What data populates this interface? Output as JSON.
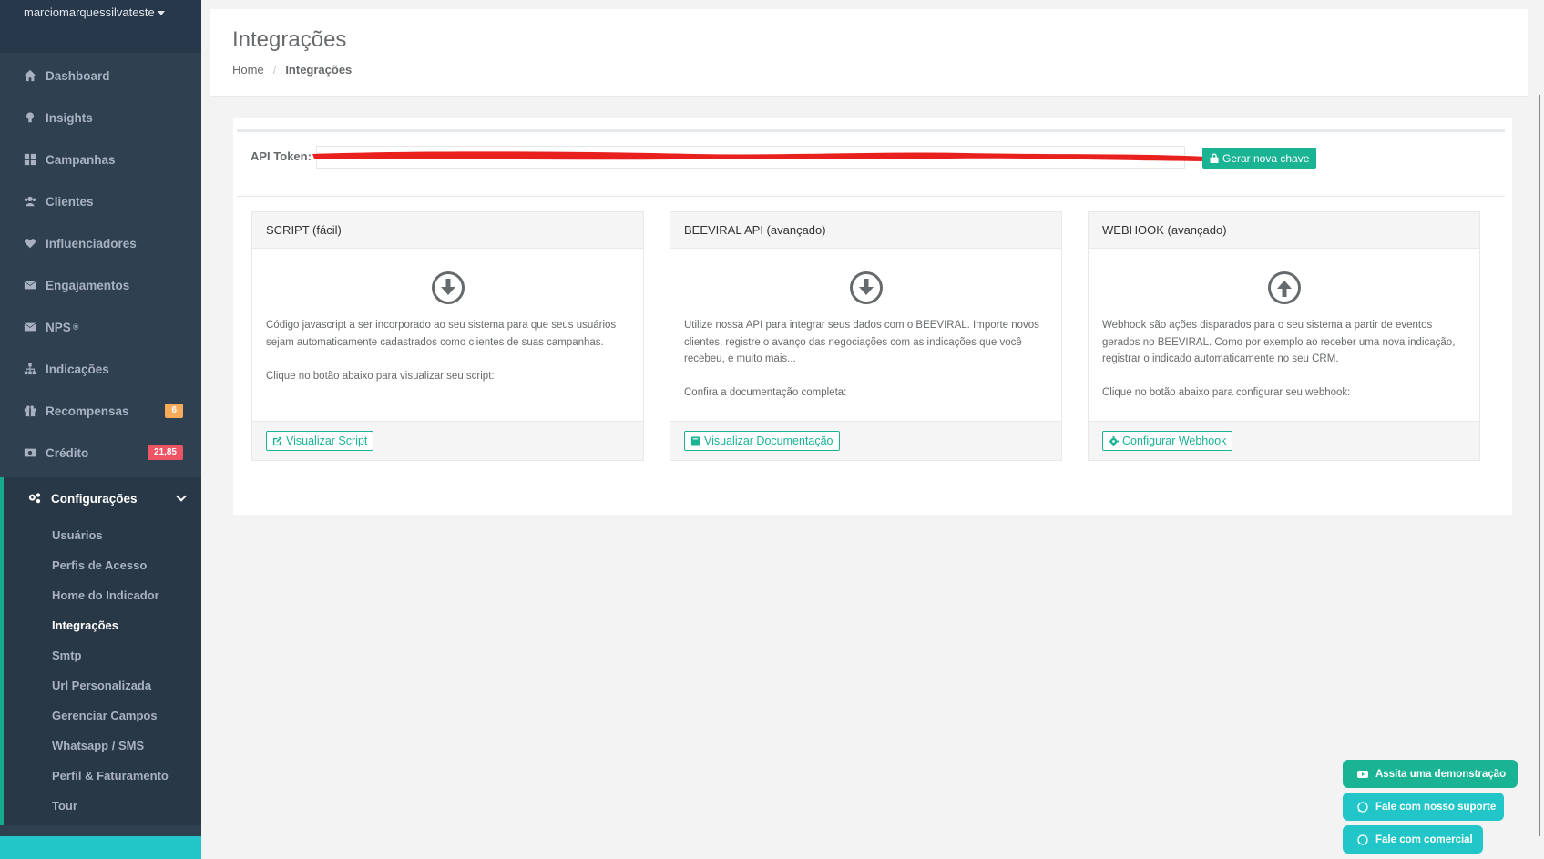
{
  "user": {
    "name": "marciomarquessilvateste"
  },
  "sidebar": {
    "items": [
      {
        "label": "Dashboard",
        "icon": "home-icon"
      },
      {
        "label": "Insights",
        "icon": "lightbulb-icon"
      },
      {
        "label": "Campanhas",
        "icon": "grid-icon"
      },
      {
        "label": "Clientes",
        "icon": "users-icon"
      },
      {
        "label": "Influenciadores",
        "icon": "heart-icon"
      },
      {
        "label": "Engajamentos",
        "icon": "envelope-icon"
      },
      {
        "label": "NPS",
        "sup": "®",
        "icon": "envelope-icon"
      },
      {
        "label": "Indicações",
        "icon": "sitemap-icon"
      },
      {
        "label": "Recompensas",
        "icon": "gift-icon",
        "badge": "6"
      },
      {
        "label": "Crédito",
        "icon": "money-icon",
        "badge": "21,85"
      }
    ],
    "config": {
      "label": "Configurações",
      "subitems": [
        "Usuários",
        "Perfis de Acesso",
        "Home do Indicador",
        "Integrações",
        "Smtp",
        "Url Personalizada",
        "Gerenciar Campos",
        "Whatsapp / SMS",
        "Perfil & Faturamento",
        "Tour"
      ]
    }
  },
  "header": {
    "title": "Integrações",
    "breadcrumb": {
      "home": "Home",
      "current": "Integrações"
    }
  },
  "token": {
    "label": "API Token:",
    "button": "Gerar nova chave"
  },
  "cards": [
    {
      "title": "SCRIPT (fácil)",
      "icon": "download-circle-icon",
      "text1": "Código javascript a ser incorporado ao seu sistema para que seus usuários sejam automaticamente cadastrados como clientes de suas campanhas.",
      "text2": "Clique no botão abaixo para visualizar seu script:",
      "button": "Visualizar Script"
    },
    {
      "title": "BEEVIRAL API (avançado)",
      "icon": "download-circle-icon",
      "text1": "Utilize nossa API para integrar seus dados com o BEEVIRAL. Importe novos clientes, registre o avanço das negociações com as indicações que você recebeu, e muito mais...",
      "text2": "Confira a documentação completa:",
      "button": "Visualizar Documentação"
    },
    {
      "title": "WEBHOOK (avançado)",
      "icon": "upload-circle-icon",
      "text1": "Webhook são ações disparados para o seu sistema a partir de eventos gerados no BEEVIRAL. Como por exemplo ao receber uma nova indicação, registrar o indicado automaticamente no seu CRM.",
      "text2": "Clique no botão abaixo para configurar seu webhook:",
      "button": "Configurar Webhook"
    }
  ],
  "floating": {
    "demo": "Assita uma demonstração",
    "support": "Fale com nosso suporte",
    "sales": "Fale com comercial"
  }
}
